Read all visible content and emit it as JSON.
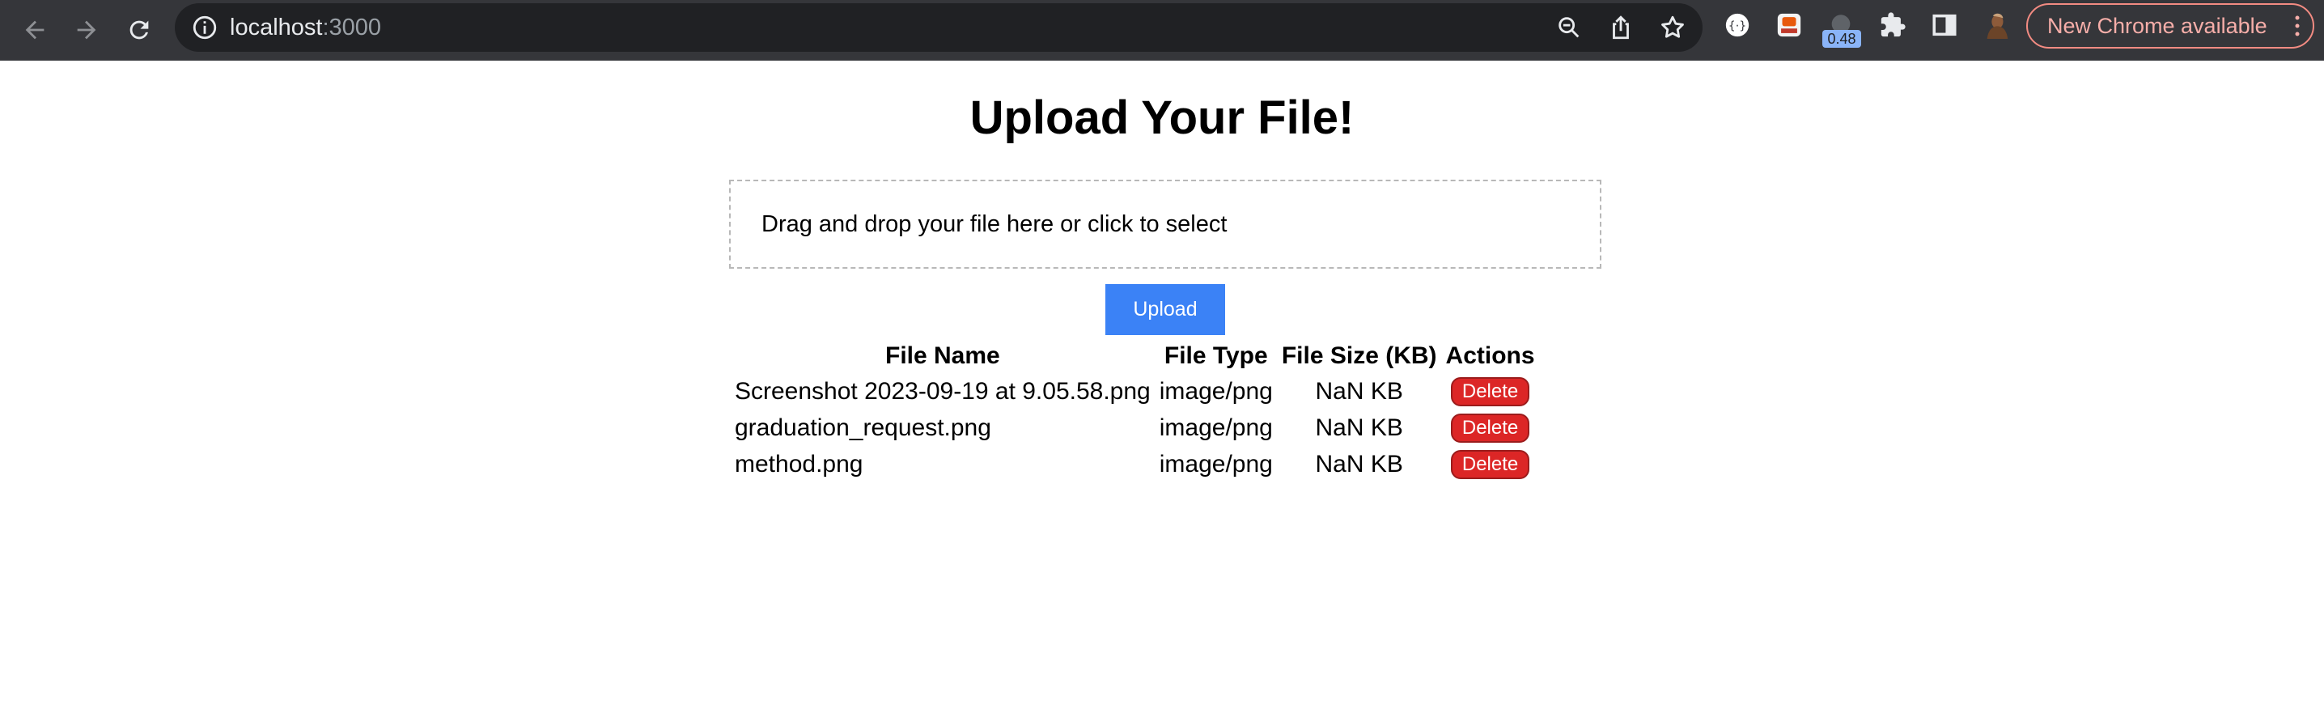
{
  "browser": {
    "url_host": "localhost",
    "url_port": ":3000",
    "extension_badge": "0.48",
    "update_label": "New Chrome available",
    "icons": [
      "back-icon",
      "forward-icon",
      "reload-icon",
      "site-info-icon",
      "zoom-icon",
      "share-icon",
      "bookmark-star-icon",
      "extension-icon",
      "puzzle-icon",
      "side-panel-icon",
      "profile-avatar",
      "more-icon"
    ]
  },
  "page": {
    "title": "Upload Your File!",
    "dropzone_text": "Drag and drop your file here or click to select",
    "upload_label": "Upload"
  },
  "table": {
    "headers": [
      "File Name",
      "File Type",
      "File Size (KB)",
      "Actions"
    ],
    "rows": [
      {
        "name": "Screenshot 2023-09-19 at 9.05.58.png",
        "type": "image/png",
        "size": "NaN KB",
        "action": "Delete"
      },
      {
        "name": "graduation_request.png",
        "type": "image/png",
        "size": "NaN KB",
        "action": "Delete"
      },
      {
        "name": "method.png",
        "type": "image/png",
        "size": "NaN KB",
        "action": "Delete"
      }
    ]
  },
  "colors": {
    "toolbar_bg": "#35363a",
    "omnibox_bg": "#202124",
    "upload_button": "#3b82f6",
    "delete_button": "#dc2626",
    "update_chip_border": "#f28b82"
  }
}
